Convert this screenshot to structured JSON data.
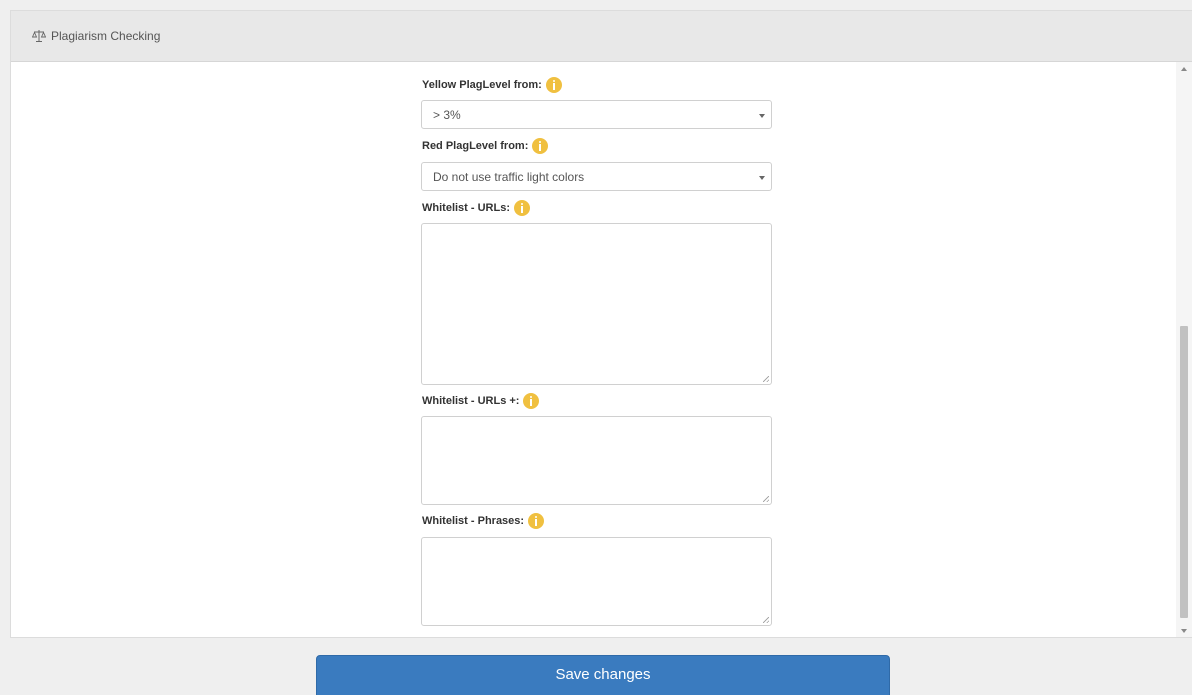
{
  "panel": {
    "title": "Plagiarism Checking",
    "icon": "balance-scale-icon"
  },
  "fields": {
    "yellow_level": {
      "label": "Yellow PlagLevel from:",
      "value": "> 3%"
    },
    "red_level": {
      "label": "Red PlagLevel from:",
      "value": "Do not use traffic light colors"
    },
    "whitelist_urls": {
      "label": "Whitelist - URLs:",
      "value": ""
    },
    "whitelist_urls_plus": {
      "label": "Whitelist - URLs +:",
      "value": ""
    },
    "whitelist_phrases": {
      "label": "Whitelist - Phrases:",
      "value": ""
    }
  },
  "actions": {
    "save_label": "Save changes"
  },
  "colors": {
    "info_icon": "#f0c040",
    "save_button": "#3a7bbf",
    "header_bg": "#e8e8e8"
  }
}
